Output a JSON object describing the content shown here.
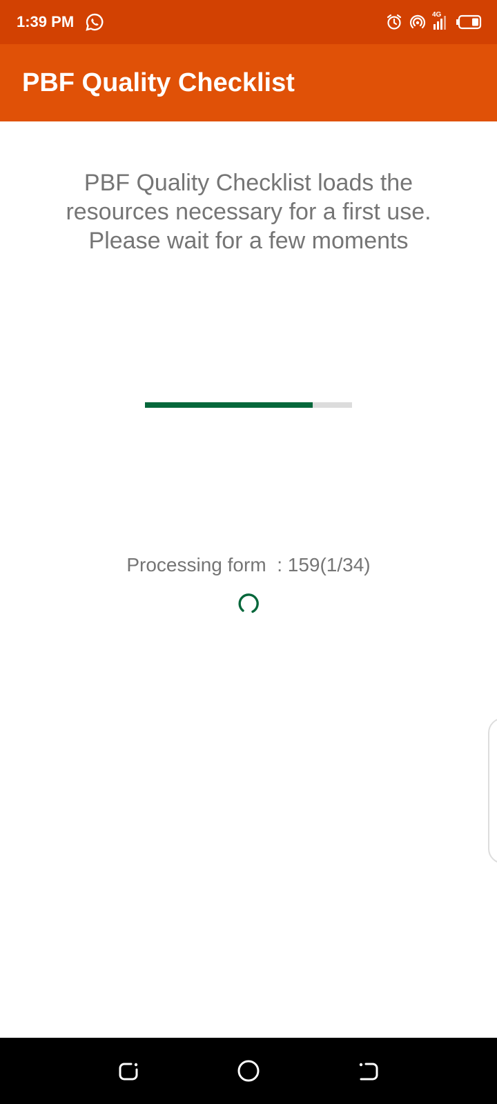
{
  "colors": {
    "status_bar": "#D24102",
    "app_bar": "#E05107",
    "progress_fill": "#06673B",
    "progress_track": "#DCDCDC",
    "spinner": "#06673B"
  },
  "status_bar": {
    "time": "1:39 PM",
    "network_label": "4G",
    "icons": [
      "whatsapp-icon",
      "alarm-icon",
      "hotspot-icon",
      "signal-icon",
      "battery-icon"
    ]
  },
  "app_bar": {
    "title": "PBF Quality Checklist"
  },
  "content": {
    "message_lines": [
      "PBF Quality Checklist loads the",
      "resources necessary for a first use.",
      "Please wait for a few moments"
    ],
    "progress": 0.81,
    "processing_text": "Processing form  : 159(1/34)"
  },
  "nav_bar": {
    "icons": [
      "recents-icon",
      "home-icon",
      "back-icon"
    ]
  }
}
